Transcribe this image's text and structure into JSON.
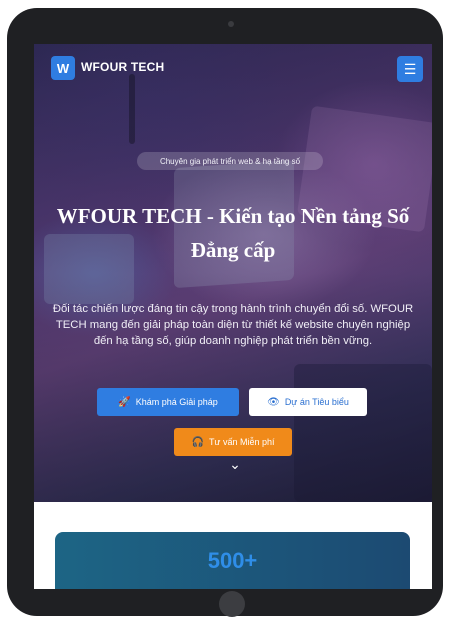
{
  "brand": {
    "logo_letter": "W",
    "name": "WFOUR TECH",
    "accent": "#2f7de1"
  },
  "nav": {
    "menu_icon": "hamburger-icon"
  },
  "hero": {
    "badge": "Chuyên gia phát triển web & hạ tầng số",
    "title": "WFOUR TECH - Kiến tạo Nền tảng Số Đẳng cấp",
    "description": "Đối tác chiến lược đáng tin cậy trong hành trình chuyển đổi số. WFOUR TECH mang đến giải pháp toàn diện từ thiết kế website chuyên nghiệp đến hạ tầng số, giúp doanh nghiệp phát triển bền vững.",
    "buttons": {
      "explore": {
        "label": "Khám phá Giải pháp",
        "icon": "rocket-icon"
      },
      "projects": {
        "label": "Dự án Tiêu biểu",
        "icon": "eye-icon"
      },
      "consult": {
        "label": "Tư vấn Miễn phí",
        "icon": "headset-icon"
      }
    },
    "scroll_icon": "chevron-down-icon"
  },
  "stats": {
    "first_value": "500+"
  }
}
